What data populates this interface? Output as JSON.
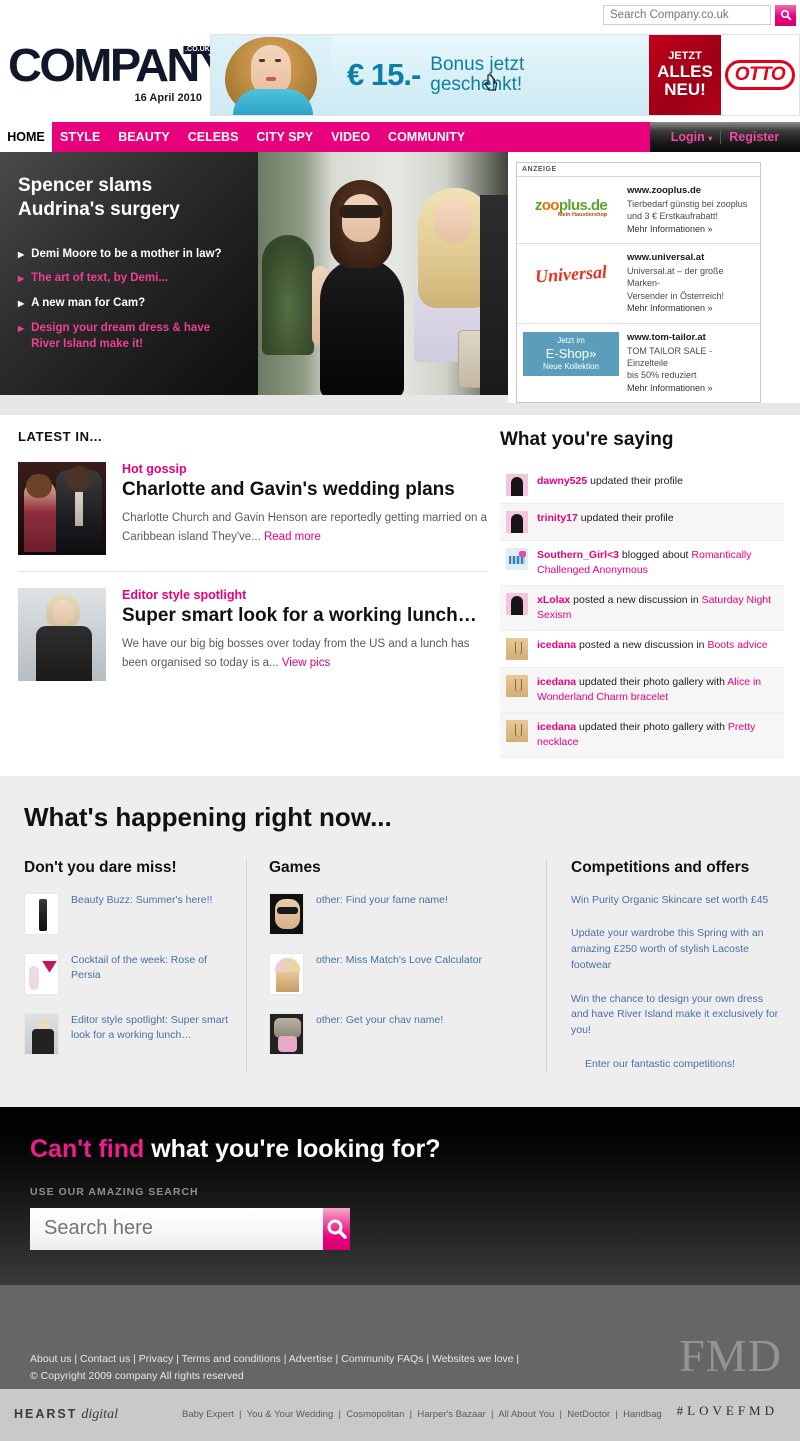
{
  "top_search": {
    "placeholder": "Search Company.co.uk",
    "button_icon": "search-icon"
  },
  "header": {
    "logo": "COMPANY",
    "logo_sup": ".CO.UK",
    "date": "16 April 2010"
  },
  "banner_ad": {
    "price": "€ 15.-",
    "text_line1": "Bonus jetzt",
    "text_line2": "geschenkt!",
    "badge_line1": "JETZT",
    "badge_line2": "ALLES",
    "badge_line3": "NEU!",
    "brand": "OTTO"
  },
  "nav": {
    "home": "HOME",
    "items": [
      "STYLE",
      "BEAUTY",
      "CELEBS",
      "CITY SPY",
      "VIDEO",
      "COMMUNITY"
    ],
    "login": "Login",
    "login_caret": "▾",
    "register": "Register"
  },
  "hero": {
    "title_line1": "Spencer slams",
    "title_line2": "Audrina's surgery",
    "links": [
      {
        "text": "Demi Moore to be a mother in law?",
        "style": "white"
      },
      {
        "text": "The art of text, by Demi...",
        "style": "pink"
      },
      {
        "text": "A new man for Cam?",
        "style": "white"
      },
      {
        "text": "Design your dream dress & have River Island make it!",
        "style": "pink"
      }
    ]
  },
  "ad_box": {
    "header": "ANZEIGE",
    "items": [
      {
        "logo_kind": "zooplus",
        "logo_text": "zooplus.de",
        "logo_sub": "Mein Haustiershop",
        "url": "www.zooplus.de",
        "desc_line1": "Tierbedarf günstig bei zooplus",
        "desc_line2": "und 3 € Erstkaufrabatt!",
        "more": "Mehr Informationen »"
      },
      {
        "logo_kind": "universal",
        "logo_text": "Universal",
        "url": "www.universal.at",
        "desc_line1": "Universal.at – der große Marken-",
        "desc_line2": "Versender in Österreich!",
        "more": "Mehr Informationen »"
      },
      {
        "logo_kind": "tomtailor",
        "logo_line1": "Jetzt im",
        "logo_line2": "E-Shop»",
        "logo_line3": "Neue Kollektion",
        "url": "www.tom-tailor.at",
        "desc_line1": "TOM TAILOR SALE - Einzelteile",
        "desc_line2": "bis 50% reduziert",
        "more": "Mehr Informationen »"
      }
    ]
  },
  "latest": {
    "heading": "LATEST IN...",
    "stories": [
      {
        "kicker": "Hot gossip",
        "title": "Charlotte and Gavin's wedding plans",
        "text": "Charlotte Church and Gavin Henson are reportedly getting married on a Caribbean island They've... ",
        "link": "Read more",
        "thumb": "couple-photo"
      },
      {
        "kicker": "Editor style spotlight",
        "title": "Super smart look for a working lunch…",
        "text": "We have our big big bosses over today from the US and a lunch has been organised so today is a... ",
        "link": "View pics",
        "thumb": "editor-photo"
      }
    ]
  },
  "saying": {
    "heading": "What you're saying",
    "rows": [
      {
        "user": "dawny525",
        "action": " updated their profile",
        "object": "",
        "avatar": "girl-silhouette-avatar"
      },
      {
        "user": "trinity17",
        "action": " updated their profile",
        "object": "",
        "avatar": "girl-silhouette-avatar"
      },
      {
        "user": "Southern_Girl<3",
        "action": " blogged about ",
        "object": "Romantically Challenged Anonymous",
        "avatar": "blue-pixel-avatar"
      },
      {
        "user": "xLolax",
        "action": " posted a new discussion in ",
        "object": "Saturday Night Sexism",
        "avatar": "girl-silhouette-avatar"
      },
      {
        "user": "icedana",
        "action": " posted a new discussion in ",
        "object": "Boots advice",
        "avatar": "necklace-avatar"
      },
      {
        "user": "icedana",
        "action": " updated their photo gallery with ",
        "object": "Alice in Wonderland Charm bracelet",
        "avatar": "necklace-avatar"
      },
      {
        "user": "icedana",
        "action": " updated their photo gallery with ",
        "object": "Pretty necklace",
        "avatar": "necklace-avatar"
      }
    ]
  },
  "happening": {
    "title": "What's happening right now...",
    "col1": {
      "heading": "Don't you dare miss!",
      "items": [
        {
          "label": "Beauty Buzz: Summer's here!!",
          "thumb": "mascara-thumb"
        },
        {
          "label": "Cocktail of the week: Rose of Persia",
          "thumb": "cocktail-thumb"
        },
        {
          "label": "Editor style spotlight: Super smart look for a working lunch…",
          "thumb": "editor-thumb"
        }
      ]
    },
    "col2": {
      "heading": "Games",
      "items": [
        {
          "label": "other: Find your fame name!",
          "thumb": "game-fame-thumb"
        },
        {
          "label": "other: Miss Match's Love Calculator",
          "thumb": "game-love-thumb"
        },
        {
          "label": "other: Get your chav name!",
          "thumb": "game-chav-thumb"
        }
      ]
    },
    "col3": {
      "heading": "Competitions and offers",
      "items": [
        "Win Purity Organic Skincare set worth £45",
        "Update your wardrobe this Spring with an amazing £250 worth of stylish Lacoste footwear",
        "Win the chance to design your own dress and have River Island make it exclusively for you!"
      ],
      "cta": "Enter our fantastic competitions!"
    }
  },
  "big_search": {
    "title_highlight": "Can't find",
    "title_rest": " what you're looking for?",
    "subtitle": "USE OUR AMAZING SEARCH",
    "placeholder": "Search here",
    "button_icon": "search-icon"
  },
  "footer": {
    "links": [
      "About us",
      "Contact us",
      "Privacy",
      "Terms and conditions",
      "Advertise",
      "Community FAQs",
      "Websites we love"
    ],
    "copyright": "© Copyright 2009 company All rights reserved",
    "watermark": "FMD",
    "hearst_bold": "HEARST",
    "hearst_italic": "digital",
    "partner_links": [
      "Baby Expert",
      "You & Your Wedding",
      "Cosmopolitan",
      "Harper's Bazaar",
      "All About You",
      "NetDoctor",
      "Handbag"
    ],
    "love_fmd": "#LOVEFMD"
  }
}
